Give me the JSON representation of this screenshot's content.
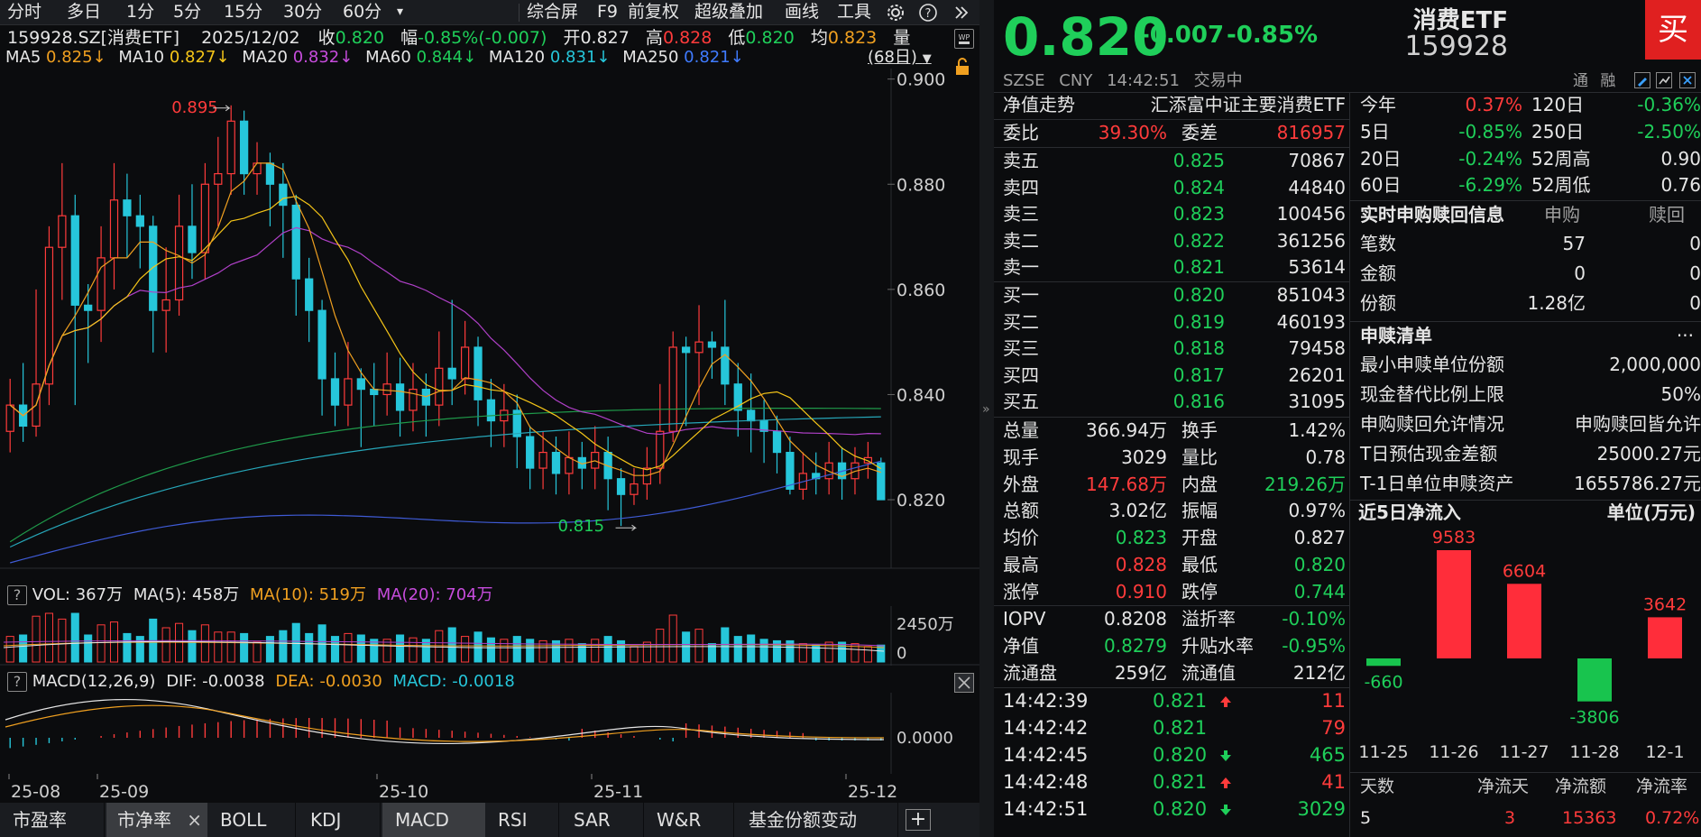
{
  "toolbar": {
    "periods": [
      "分时",
      "多日",
      "1分",
      "5分",
      "15分",
      "30分",
      "60分"
    ],
    "dropdown": "▾",
    "right_items": [
      "综合屏",
      "F9",
      "前复权",
      "超级叠加",
      "画线",
      "工具"
    ]
  },
  "quote_line": {
    "code": "159928.SZ[消费ETF]",
    "date": "2025/12/02",
    "close_label": "收",
    "close": "0.820",
    "range_label": "幅",
    "range": "-0.85%(-0.007)",
    "open_label": "开",
    "open": "0.827",
    "high_label": "高",
    "high": "0.828",
    "low_label": "低",
    "low": "0.820",
    "avg_label": "均",
    "avg": "0.823",
    "vol_label": "量"
  },
  "ma_line": {
    "ma5": "MA5",
    "ma5_v": "0.825↓",
    "ma10": "MA10",
    "ma10_v": "0.827↓",
    "ma20": "MA20",
    "ma20_v": "0.832↓",
    "ma60": "MA60",
    "ma60_v": "0.844↓",
    "ma120": "MA120",
    "ma120_v": "0.831↓",
    "ma250": "MA250",
    "ma250_v": "0.821↓",
    "days": "(68日)"
  },
  "chart_data": {
    "type": "candlestick",
    "y_ticks": [
      "0.900",
      "0.880",
      "0.860",
      "0.840",
      "0.820"
    ],
    "ylim": [
      0.808,
      0.902
    ],
    "x_ticks": [
      "25-08",
      "25-09",
      "25-10",
      "25-11",
      "25-12"
    ],
    "high_annot": "0.895",
    "low_annot": "0.815",
    "candles": [
      [
        0.833,
        0.838,
        0.843,
        0.829
      ],
      [
        0.838,
        0.834,
        0.846,
        0.831
      ],
      [
        0.834,
        0.842,
        0.86,
        0.832
      ],
      [
        0.842,
        0.868,
        0.872,
        0.838
      ],
      [
        0.868,
        0.874,
        0.884,
        0.858
      ],
      [
        0.874,
        0.857,
        0.878,
        0.838
      ],
      [
        0.857,
        0.856,
        0.861,
        0.846
      ],
      [
        0.856,
        0.866,
        0.872,
        0.85
      ],
      [
        0.866,
        0.877,
        0.884,
        0.86
      ],
      [
        0.877,
        0.874,
        0.882,
        0.866
      ],
      [
        0.874,
        0.872,
        0.878,
        0.864
      ],
      [
        0.872,
        0.856,
        0.874,
        0.848
      ],
      [
        0.856,
        0.858,
        0.868,
        0.848
      ],
      [
        0.858,
        0.872,
        0.878,
        0.855
      ],
      [
        0.872,
        0.867,
        0.88,
        0.862
      ],
      [
        0.867,
        0.88,
        0.884,
        0.862
      ],
      [
        0.88,
        0.882,
        0.889,
        0.872
      ],
      [
        0.882,
        0.892,
        0.895,
        0.878
      ],
      [
        0.892,
        0.882,
        0.894,
        0.878
      ],
      [
        0.882,
        0.884,
        0.888,
        0.878
      ],
      [
        0.884,
        0.88,
        0.886,
        0.872
      ],
      [
        0.88,
        0.876,
        0.884,
        0.866
      ],
      [
        0.876,
        0.862,
        0.878,
        0.855
      ],
      [
        0.862,
        0.856,
        0.866,
        0.85
      ],
      [
        0.856,
        0.843,
        0.858,
        0.836
      ],
      [
        0.843,
        0.838,
        0.848,
        0.834
      ],
      [
        0.838,
        0.843,
        0.85,
        0.834
      ],
      [
        0.843,
        0.841,
        0.845,
        0.83
      ],
      [
        0.841,
        0.84,
        0.846,
        0.834
      ],
      [
        0.84,
        0.842,
        0.848,
        0.836
      ],
      [
        0.842,
        0.837,
        0.847,
        0.832
      ],
      [
        0.837,
        0.841,
        0.846,
        0.833
      ],
      [
        0.841,
        0.838,
        0.844,
        0.832
      ],
      [
        0.838,
        0.845,
        0.852,
        0.834
      ],
      [
        0.845,
        0.843,
        0.858,
        0.838
      ],
      [
        0.843,
        0.849,
        0.854,
        0.84
      ],
      [
        0.849,
        0.839,
        0.851,
        0.834
      ],
      [
        0.839,
        0.835,
        0.843,
        0.83
      ],
      [
        0.835,
        0.837,
        0.842,
        0.83
      ],
      [
        0.837,
        0.832,
        0.84,
        0.826
      ],
      [
        0.832,
        0.826,
        0.834,
        0.822
      ],
      [
        0.826,
        0.829,
        0.833,
        0.822
      ],
      [
        0.829,
        0.825,
        0.832,
        0.821
      ],
      [
        0.825,
        0.828,
        0.833,
        0.821
      ],
      [
        0.828,
        0.826,
        0.831,
        0.822
      ],
      [
        0.826,
        0.829,
        0.834,
        0.822
      ],
      [
        0.829,
        0.824,
        0.832,
        0.818
      ],
      [
        0.824,
        0.821,
        0.826,
        0.815
      ],
      [
        0.821,
        0.823,
        0.826,
        0.819
      ],
      [
        0.823,
        0.826,
        0.83,
        0.82
      ],
      [
        0.826,
        0.833,
        0.842,
        0.823
      ],
      [
        0.833,
        0.849,
        0.852,
        0.831
      ],
      [
        0.849,
        0.848,
        0.851,
        0.834
      ],
      [
        0.848,
        0.85,
        0.857,
        0.838
      ],
      [
        0.85,
        0.849,
        0.852,
        0.843
      ],
      [
        0.849,
        0.842,
        0.858,
        0.838
      ],
      [
        0.842,
        0.837,
        0.846,
        0.832
      ],
      [
        0.837,
        0.835,
        0.844,
        0.829
      ],
      [
        0.835,
        0.833,
        0.839,
        0.827
      ],
      [
        0.833,
        0.829,
        0.836,
        0.825
      ],
      [
        0.829,
        0.822,
        0.832,
        0.821
      ],
      [
        0.822,
        0.825,
        0.829,
        0.82
      ],
      [
        0.825,
        0.824,
        0.829,
        0.821
      ],
      [
        0.824,
        0.827,
        0.831,
        0.821
      ],
      [
        0.827,
        0.824,
        0.83,
        0.82
      ],
      [
        0.824,
        0.827,
        0.83,
        0.821
      ],
      [
        0.827,
        0.828,
        0.831,
        0.824
      ],
      [
        0.827,
        0.82,
        0.828,
        0.82
      ]
    ],
    "vol_ticks": [
      "2450万",
      "0"
    ],
    "macd_tick": "0.0000"
  },
  "vol_header": {
    "q": "?",
    "vol": "VOL: 367万",
    "ma5": "MA(5): 458万",
    "ma10": "MA(10): 519万",
    "ma20": "MA(20): 704万"
  },
  "macd_header": {
    "q": "?",
    "title": "MACD(12,26,9)",
    "dif": "DIF: -0.0038",
    "dea": "DEA: -0.0030",
    "macd": "MACD: -0.0018"
  },
  "bottom_tabs": [
    "市盈率",
    "市净率",
    "BOLL",
    "KDJ",
    "MACD",
    "RSI",
    "SAR",
    "W&R",
    "基金份额变动"
  ],
  "close_x": "×",
  "plus": "+",
  "header": {
    "price": "0.820",
    "change": "-0.007",
    "change_pct": "-0.85%",
    "name": "消费ETF",
    "code": "159928",
    "buy": "买",
    "exchange": "SZSE",
    "currency": "CNY",
    "time": "14:42:51",
    "status": "交易中",
    "tong": "通",
    "rong": "融"
  },
  "fund": {
    "label": "净值走势",
    "name": "汇添富中证主要消费ETF"
  },
  "weibi": {
    "label": "委比",
    "value": "39.30%",
    "label2": "委差",
    "value2": "816957"
  },
  "asks": [
    {
      "label": "卖五",
      "price": "0.825",
      "vol": "70867"
    },
    {
      "label": "卖四",
      "price": "0.824",
      "vol": "44840"
    },
    {
      "label": "卖三",
      "price": "0.823",
      "vol": "100456"
    },
    {
      "label": "卖二",
      "price": "0.822",
      "vol": "361256"
    },
    {
      "label": "卖一",
      "price": "0.821",
      "vol": "53614"
    }
  ],
  "bids": [
    {
      "label": "买一",
      "price": "0.820",
      "vol": "851043"
    },
    {
      "label": "买二",
      "price": "0.819",
      "vol": "460193"
    },
    {
      "label": "买三",
      "price": "0.818",
      "vol": "79458"
    },
    {
      "label": "买四",
      "price": "0.817",
      "vol": "26201"
    },
    {
      "label": "买五",
      "price": "0.816",
      "vol": "31095"
    }
  ],
  "stats": [
    {
      "l1": "总量",
      "v1": "366.94万",
      "c1": "white",
      "l2": "换手",
      "v2": "1.42%",
      "c2": "white"
    },
    {
      "l1": "现手",
      "v1": "3029",
      "c1": "white",
      "l2": "量比",
      "v2": "0.78",
      "c2": "white"
    },
    {
      "l1": "外盘",
      "v1": "147.68万",
      "c1": "red",
      "l2": "内盘",
      "v2": "219.26万",
      "c2": "green"
    },
    {
      "l1": "总额",
      "v1": "3.02亿",
      "c1": "white",
      "l2": "振幅",
      "v2": "0.97%",
      "c2": "white"
    },
    {
      "l1": "均价",
      "v1": "0.823",
      "c1": "green",
      "l2": "开盘",
      "v2": "0.827",
      "c2": "white"
    },
    {
      "l1": "最高",
      "v1": "0.828",
      "c1": "red",
      "l2": "最低",
      "v2": "0.820",
      "c2": "green"
    },
    {
      "l1": "涨停",
      "v1": "0.910",
      "c1": "red",
      "l2": "跌停",
      "v2": "0.744",
      "c2": "green"
    }
  ],
  "iopv": [
    {
      "l1": "IOPV",
      "v1": "0.8208",
      "c1": "white",
      "l2": "溢折率",
      "v2": "-0.10%",
      "c2": "green"
    },
    {
      "l1": "净值",
      "v1": "0.8279",
      "c1": "green",
      "l2": "升贴水率",
      "v2": "-0.95%",
      "c2": "green"
    },
    {
      "l1": "流通盘",
      "v1": "259亿",
      "c1": "white",
      "l2": "流通值",
      "v2": "212亿",
      "c2": "white"
    }
  ],
  "ticks": [
    {
      "time": "14:42:39",
      "price": "0.821",
      "dir": "up",
      "vol": "11"
    },
    {
      "time": "14:42:42",
      "price": "0.821",
      "dir": "",
      "vol": "79"
    },
    {
      "time": "14:42:45",
      "price": "0.820",
      "dir": "down",
      "vol": "465"
    },
    {
      "time": "14:42:48",
      "price": "0.821",
      "dir": "up",
      "vol": "41"
    },
    {
      "time": "14:42:51",
      "price": "0.820",
      "dir": "down",
      "vol": "3029"
    }
  ],
  "perf": [
    {
      "l1": "今年",
      "v1": "0.37%",
      "c1": "red",
      "l2": "120日",
      "v2": "-0.36%",
      "c2": "green"
    },
    {
      "l1": "5日",
      "v1": "-0.85%",
      "c1": "green",
      "l2": "250日",
      "v2": "-2.50%",
      "c2": "green"
    },
    {
      "l1": "20日",
      "v1": "-0.24%",
      "c1": "green",
      "l2": "52周高",
      "v2": "0.90",
      "c2": "white"
    },
    {
      "l1": "60日",
      "v1": "-6.29%",
      "c1": "green",
      "l2": "52周低",
      "v2": "0.76",
      "c2": "white"
    }
  ],
  "subscribe": {
    "title": "实时申购赎回信息",
    "col1": "申购",
    "col2": "赎回",
    "rows": [
      {
        "label": "笔数",
        "v1": "57",
        "v2": "0"
      },
      {
        "label": "金额",
        "v1": "0",
        "v2": "0"
      },
      {
        "label": "份额",
        "v1": "1.28亿",
        "v2": "0"
      }
    ]
  },
  "redeem_list": {
    "title": "申赎清单",
    "more": "···",
    "rows": [
      {
        "label": "最小申赎单位份额",
        "value": "2,000,000"
      },
      {
        "label": "现金替代比例上限",
        "value": "50%"
      },
      {
        "label": "申购赎回允许情况",
        "value": "申购赎回皆允许"
      },
      {
        "label": "T日预估现金差额",
        "value": "25000.27元"
      },
      {
        "label": "T-1日单位申赎资产",
        "value": "1655786.27元"
      }
    ]
  },
  "netflow": {
    "title": "近5日净流入",
    "unit": "单位(万元)",
    "categories": [
      "11-25",
      "11-26",
      "11-27",
      "11-28",
      "12-1"
    ],
    "values": [
      -660,
      9583,
      6604,
      -3806,
      3642
    ],
    "labels": [
      "-660",
      "9583",
      "6604",
      "-3806",
      "3642"
    ]
  },
  "netflow_summary": {
    "h1": "天数",
    "h2": "净流天",
    "h3": "净流额",
    "h4": "净流率",
    "v1": "5",
    "v2": "3",
    "v3": "15363",
    "v4": "0.72%"
  },
  "colors": {
    "up": "#ff3b3b",
    "down": "#26c6da",
    "bg": "#0b0c0e",
    "green": "#1fcf5a"
  }
}
